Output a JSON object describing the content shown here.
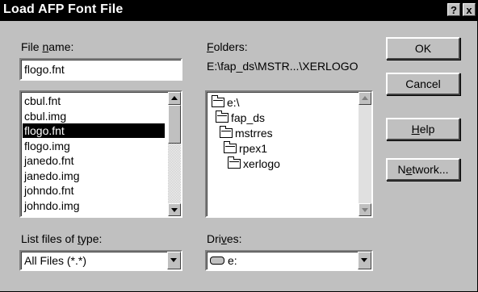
{
  "window": {
    "title": "Load AFP Font File",
    "help_btn": "?",
    "close_btn": "x"
  },
  "file_name": {
    "label_pre": "File ",
    "label_key": "n",
    "label_post": "ame:",
    "value": "flogo.fnt"
  },
  "files": [
    "cbul.fnt",
    "cbul.img",
    "flogo.fnt",
    "flogo.img",
    "janedo.fnt",
    "janedo.img",
    "johndo.fnt",
    "johndo.img"
  ],
  "selected_file": "flogo.fnt",
  "folders": {
    "label_key": "F",
    "label_post": "olders:",
    "path": "E:\\fap_ds\\MSTR...\\XERLOGO",
    "tree": [
      "e:\\",
      "fap_ds",
      "mstrres",
      "rpex1",
      "xerlogo"
    ]
  },
  "file_type": {
    "label_pre": "List files of ",
    "label_key": "t",
    "label_post": "ype:",
    "value": "All Files (*.*)"
  },
  "drives": {
    "label_pre": "Dri",
    "label_key": "v",
    "label_post": "es:",
    "value": "e:"
  },
  "buttons": {
    "ok": "OK",
    "cancel": "Cancel",
    "help_key": "H",
    "help_post": "elp",
    "network_pre": "N",
    "network_key": "e",
    "network_post": "twork..."
  }
}
